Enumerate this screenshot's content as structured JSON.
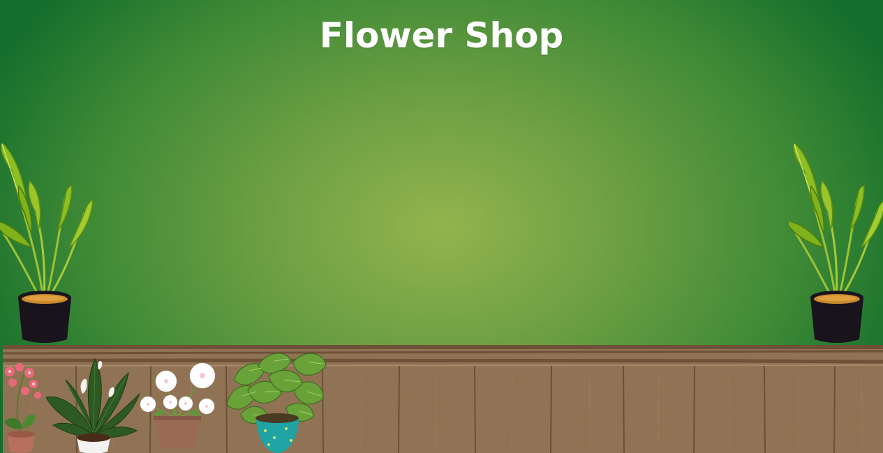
{
  "header": {
    "title": "Flower Shop"
  },
  "colors": {
    "background_center": "#93b44e",
    "background_edge": "#146e2c",
    "shelf_wood": "#8f7354",
    "shelf_trim": "#6e5136",
    "title_text": "#ffffff"
  },
  "decor": {
    "big_plants": [
      "potted-plant-icon",
      "potted-plant-icon"
    ],
    "shelf_items": [
      "pink-orchid-icon",
      "peace-lily-icon",
      "white-daisy-icon",
      "monstera-icon"
    ]
  }
}
